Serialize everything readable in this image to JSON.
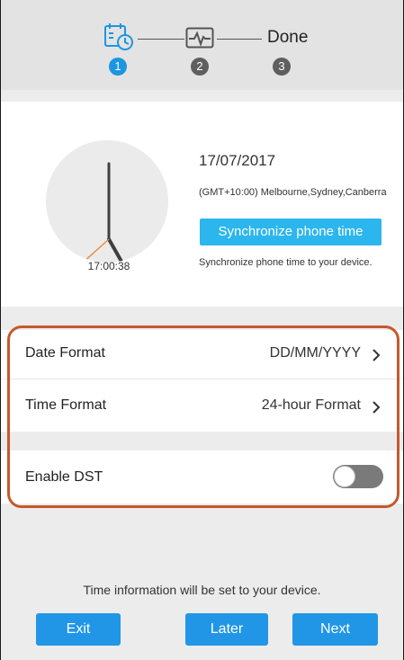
{
  "stepper": {
    "steps": [
      {
        "number": "1",
        "icon": "calendar-clock-icon",
        "state": "active"
      },
      {
        "number": "2",
        "icon": "heart-rate-monitor-icon",
        "state": "inactive"
      },
      {
        "number": "3",
        "label": "Done",
        "state": "inactive"
      }
    ]
  },
  "time_card": {
    "clock_readout": "17:00:38",
    "date": "17/07/2017",
    "timezone": "(GMT+10:00) Melbourne,Sydney,Canberra",
    "sync_button": "Synchronize phone time",
    "sync_hint": "Synchronize phone time to your device."
  },
  "settings": {
    "date_format": {
      "label": "Date Format",
      "value": "DD/MM/YYYY"
    },
    "time_format": {
      "label": "Time Format",
      "value": "24-hour Format"
    },
    "dst": {
      "label": "Enable DST",
      "enabled": false
    }
  },
  "footer": {
    "note": "Time information will be set to your device.",
    "exit": "Exit",
    "later": "Later",
    "next": "Next"
  },
  "colors": {
    "accent": "#1a96e2",
    "button": "#2196e6",
    "sync_button": "#2cb6ee",
    "highlight": "#c5592c",
    "clock_second_hand": "#f08a3e"
  }
}
